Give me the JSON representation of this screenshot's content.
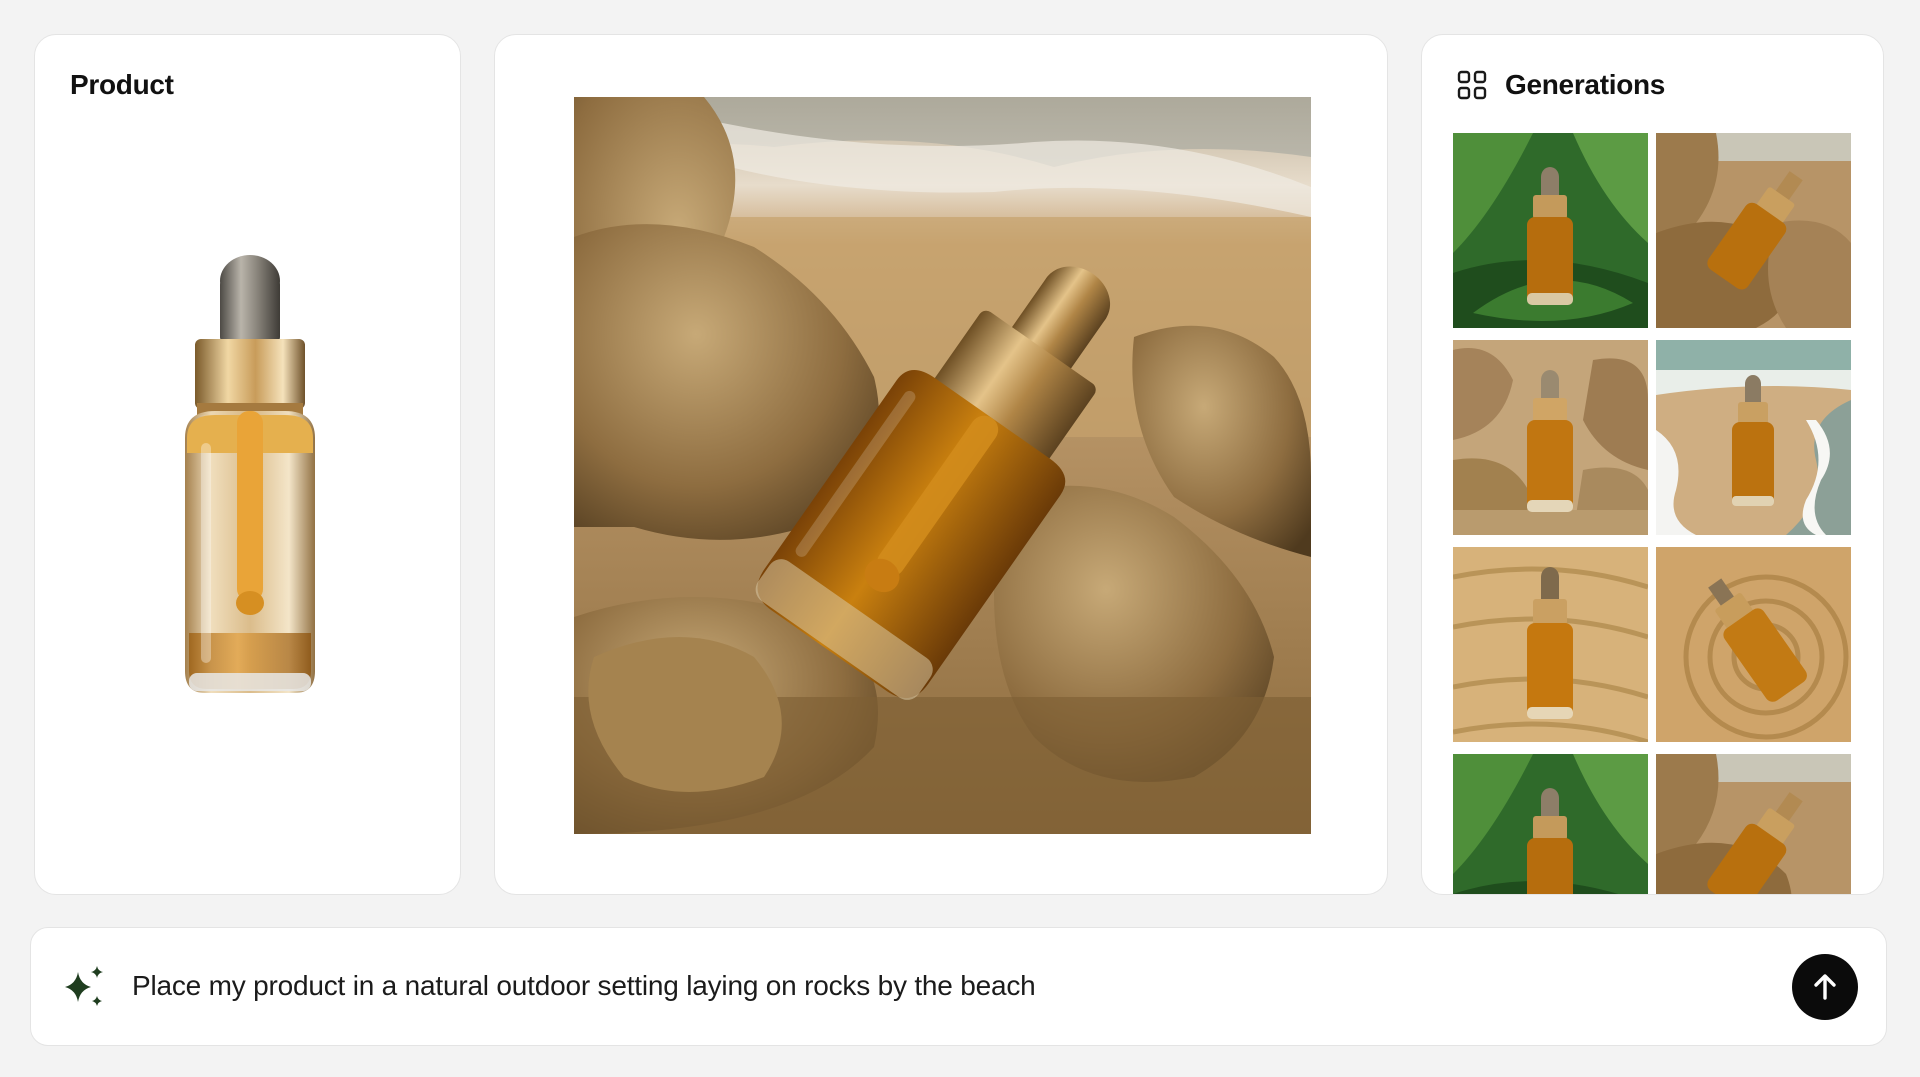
{
  "product_panel": {
    "title": "Product"
  },
  "preview_panel": {
    "image": "dropper-bottle-on-beach-rocks"
  },
  "generations_panel": {
    "title": "Generations",
    "icon": "grid-icon",
    "thumbnails": [
      {
        "scene": "leaves"
      },
      {
        "scene": "rocks"
      },
      {
        "scene": "rocks-standing"
      },
      {
        "scene": "beach-waves"
      },
      {
        "scene": "sand-ripples"
      },
      {
        "scene": "sand-swirl"
      },
      {
        "scene": "leaves"
      },
      {
        "scene": "rocks"
      }
    ]
  },
  "prompt_bar": {
    "icon": "sparkle-icon",
    "text": "Place my product in a natural outdoor setting laying on rocks by the beach",
    "send_icon": "arrow-up-icon"
  },
  "colors": {
    "background": "#f3f3f3",
    "card": "#ffffff",
    "amber": "#b8770f",
    "gold": "#c79a52",
    "sparkle": "#1f3d1f",
    "send_button": "#0b0b0b"
  }
}
